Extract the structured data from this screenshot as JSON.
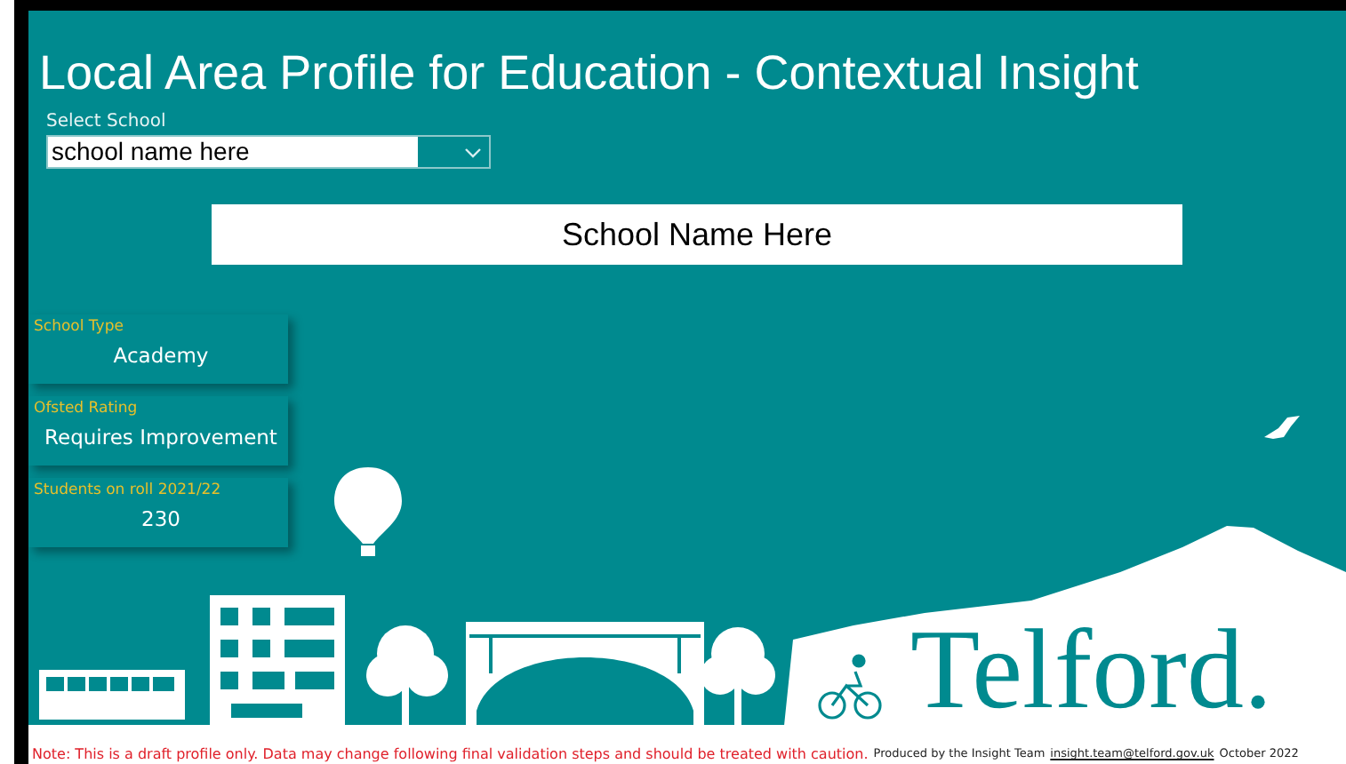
{
  "window": {
    "title": "Local Area Profile for Education - Contextual Insight"
  },
  "school_selector": {
    "label": "Select School",
    "value": "school name here"
  },
  "school_banner": {
    "name": "School Name Here"
  },
  "cards": [
    {
      "label": "School Type",
      "value": "Academy"
    },
    {
      "label": "Ofsted Rating",
      "value": "Requires Improvement"
    },
    {
      "label": "Students on roll 2021/22",
      "value": "230"
    }
  ],
  "logo": {
    "text": "Telford."
  },
  "footer": {
    "note": "Note:  This is a draft profile only. Data may change following final validation steps and should be treated with caution.",
    "credit": "Produced by the Insight Team",
    "email": "insight.team@telford.gov.uk",
    "date": "October 2022"
  }
}
